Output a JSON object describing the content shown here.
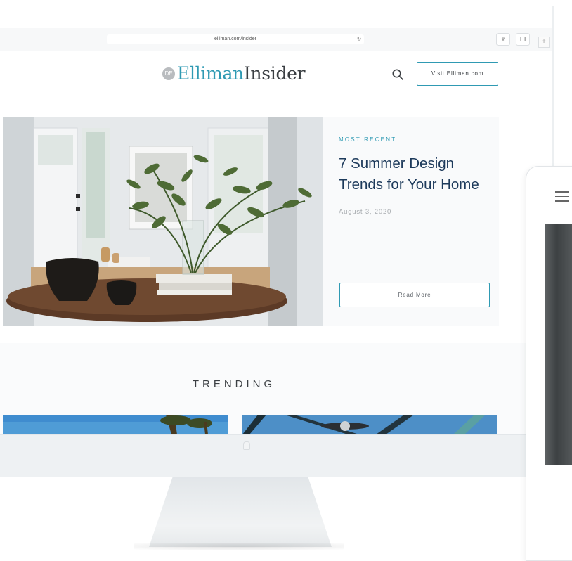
{
  "browser": {
    "url": "elliman.com/insider",
    "reload_icon": "reload-icon",
    "share_icon": "share-icon",
    "tabs_icon": "tabs-icon",
    "new_tab_label": "+"
  },
  "header": {
    "logo_part1": "Elliman",
    "logo_part2": "Insider",
    "search_icon": "search-icon",
    "visit_button": "Visit Elliman.com"
  },
  "hero": {
    "eyebrow": "MOST RECENT",
    "headline": "7 Summer Design Trends for Your Home",
    "date": "August 3, 2020",
    "read_more": "Read More"
  },
  "trending": {
    "title": "TRENDING"
  },
  "tablet": {
    "menu_icon": "hamburger-menu-icon"
  },
  "colors": {
    "accent": "#2f9ab3",
    "headline": "#1d3a5b",
    "text": "#3b3f43"
  }
}
